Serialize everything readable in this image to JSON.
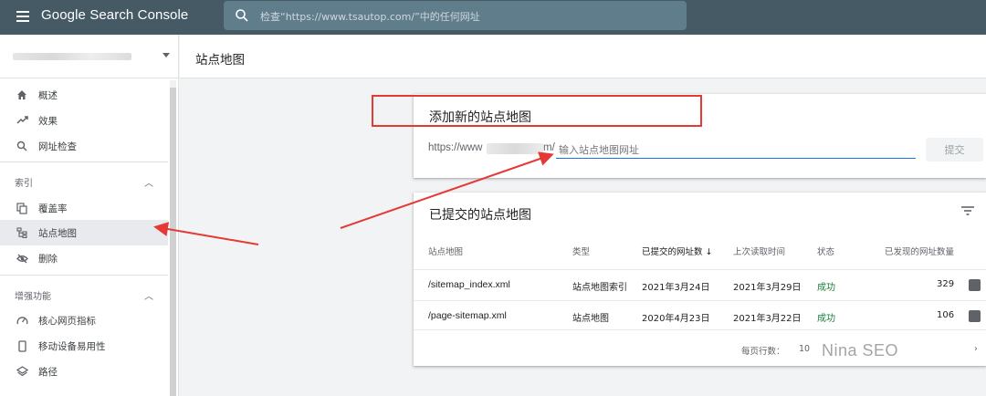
{
  "app": {
    "title": "Google Search Console",
    "search_placeholder": "检查“https://www.tsautop.com/”中的任何网址"
  },
  "sidebar": {
    "top_items": [
      {
        "label": "概述",
        "icon": "home-icon"
      },
      {
        "label": "效果",
        "icon": "trending-up-icon"
      },
      {
        "label": "网址检查",
        "icon": "search-icon"
      }
    ],
    "sections": [
      {
        "label": "索引",
        "items": [
          {
            "label": "覆盖率",
            "icon": "file-copy-icon"
          },
          {
            "label": "站点地图",
            "icon": "sitemap-icon",
            "active": true
          },
          {
            "label": "删除",
            "icon": "visibility-off-icon"
          }
        ]
      },
      {
        "label": "增强功能",
        "items": [
          {
            "label": "核心网页指标",
            "icon": "speed-gauge-icon"
          },
          {
            "label": "移动设备易用性",
            "icon": "smartphone-icon"
          },
          {
            "label": "路径",
            "icon": "layers-icon"
          }
        ]
      }
    ]
  },
  "page": {
    "title": "站点地图"
  },
  "add_card": {
    "title": "添加新的站点地图",
    "prefix_start": "https://www",
    "prefix_end": "m/",
    "input_placeholder": "输入站点地图网址",
    "submit_label": "提交"
  },
  "submitted_card": {
    "title": "已提交的站点地图",
    "columns": [
      "站点地图",
      "类型",
      "已提交的网址数",
      "上次读取时间",
      "状态",
      "已发现的网址数量"
    ],
    "rows": [
      {
        "sitemap": "/sitemap_index.xml",
        "type": "站点地图索引",
        "submitted": "2021年3月24日",
        "last_read": "2021年3月29日",
        "status": "成功",
        "discovered": "329"
      },
      {
        "sitemap": "/page-sitemap.xml",
        "type": "站点地图",
        "submitted": "2020年4月23日",
        "last_read": "2021年3月22日",
        "status": "成功",
        "discovered": "106"
      }
    ],
    "rows_per_page_label": "每页行数：",
    "rows_per_page_value": "10"
  },
  "watermark": "Nina SEO",
  "colors": {
    "topbar": "#455a64",
    "search_bg": "#607d8b",
    "status_ok": "#188038",
    "annotation_red": "#e53935",
    "input_underline": "#1a73e8"
  }
}
